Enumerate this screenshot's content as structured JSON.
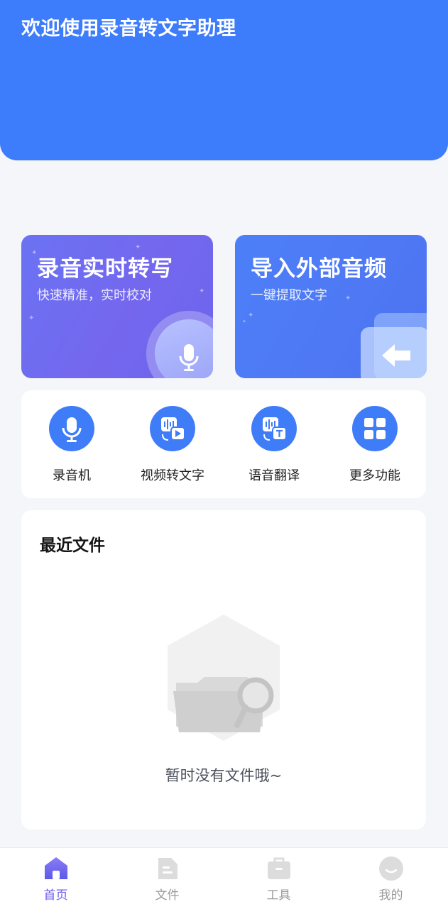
{
  "header": {
    "title": "欢迎使用录音转文字助理",
    "color": "#3d7cfb"
  },
  "cards": {
    "record": {
      "title": "录音实时转写",
      "subtitle": "快速精准，实时校对",
      "icon": "microphone-icon"
    },
    "import": {
      "title": "导入外部音频",
      "subtitle": "一键提取文字",
      "icon": "import-arrow-icon"
    }
  },
  "tools": [
    {
      "label": "录音机",
      "icon": "microphone-icon"
    },
    {
      "label": "视频转文字",
      "icon": "video-to-text-icon"
    },
    {
      "label": "语音翻译",
      "icon": "voice-translate-icon"
    },
    {
      "label": "更多功能",
      "icon": "grid-icon"
    }
  ],
  "recent": {
    "title": "最近文件",
    "empty_text": "暂时没有文件哦~"
  },
  "nav": {
    "active_color": "#6a5cf0",
    "inactive_color": "#9a9a9a",
    "items": [
      {
        "label": "首页",
        "icon": "home-icon",
        "active": true
      },
      {
        "label": "文件",
        "icon": "file-icon",
        "active": false
      },
      {
        "label": "工具",
        "icon": "toolbox-icon",
        "active": false
      },
      {
        "label": "我的",
        "icon": "profile-icon",
        "active": false
      }
    ]
  }
}
